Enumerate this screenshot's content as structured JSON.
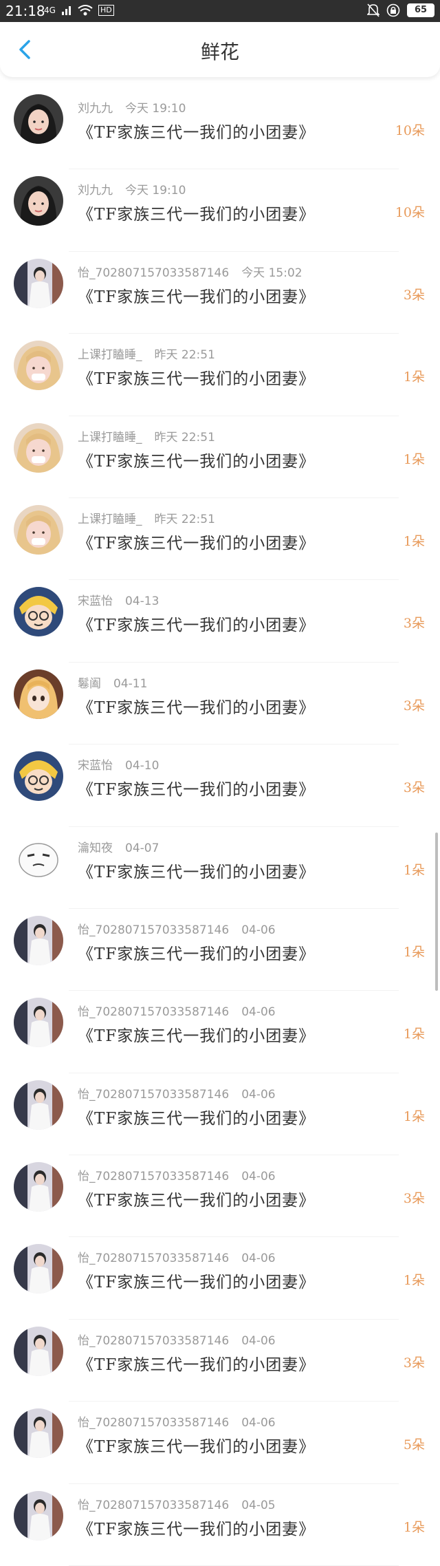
{
  "status_bar": {
    "time": "21:18",
    "signal": "4G",
    "network": "HD",
    "battery": "65"
  },
  "header": {
    "title": "鲜花"
  },
  "colors": {
    "count": "#e89a5a",
    "meta": "#9a9a9a"
  },
  "items": [
    {
      "name": "刘九九",
      "time": "今天 19:10",
      "message": "《TF家族三代一我们的小团妻》",
      "count": "10朵",
      "avatar": "girl-dark"
    },
    {
      "name": "刘九九",
      "time": "今天 19:10",
      "message": "《TF家族三代一我们的小团妻》",
      "count": "10朵",
      "avatar": "girl-dark"
    },
    {
      "name": "怡_7028071570335871​46",
      "time": "今天 15:02",
      "message": "《TF家族三代一我们的小团妻》",
      "count": "3朵",
      "avatar": "white-outfit"
    },
    {
      "name": "上课打瞌睡_",
      "time": "昨天 22:51",
      "message": "《TF家族三代一我们的小团妻》",
      "count": "1朵",
      "avatar": "blonde"
    },
    {
      "name": "上课打瞌睡_",
      "time": "昨天 22:51",
      "message": "《TF家族三代一我们的小团妻》",
      "count": "1朵",
      "avatar": "blonde"
    },
    {
      "name": "上课打瞌睡_",
      "time": "昨天 22:51",
      "message": "《TF家族三代一我们的小团妻》",
      "count": "1朵",
      "avatar": "blonde"
    },
    {
      "name": "宋蓝怡",
      "time": "04-13",
      "message": "《TF家族三代一我们的小团妻》",
      "count": "3朵",
      "avatar": "cartoon-glasses"
    },
    {
      "name": "鬈阖",
      "time": "04-11",
      "message": "《TF家族三代一我们的小团妻》",
      "count": "3朵",
      "avatar": "anime"
    },
    {
      "name": "宋蓝怡",
      "time": "04-10",
      "message": "《TF家族三代一我们的小团妻》",
      "count": "3朵",
      "avatar": "cartoon-glasses"
    },
    {
      "name": "瀹知夜",
      "time": "04-07",
      "message": "《TF家族三代一我们的小团妻》",
      "count": "1朵",
      "avatar": "meme-face"
    },
    {
      "name": "怡_702807157033587146",
      "time": "04-06",
      "message": "《TF家族三代一我们的小团妻》",
      "count": "1朵",
      "avatar": "white-outfit"
    },
    {
      "name": "怡_702807157033587146",
      "time": "04-06",
      "message": "《TF家族三代一我们的小团妻》",
      "count": "1朵",
      "avatar": "white-outfit"
    },
    {
      "name": "怡_702807157033587146",
      "time": "04-06",
      "message": "《TF家族三代一我们的小团妻》",
      "count": "1朵",
      "avatar": "white-outfit"
    },
    {
      "name": "怡_702807157033587146",
      "time": "04-06",
      "message": "《TF家族三代一我们的小团妻》",
      "count": "3朵",
      "avatar": "white-outfit"
    },
    {
      "name": "怡_702807157033587146",
      "time": "04-06",
      "message": "《TF家族三代一我们的小团妻》",
      "count": "1朵",
      "avatar": "white-outfit"
    },
    {
      "name": "怡_702807157033587146",
      "time": "04-06",
      "message": "《TF家族三代一我们的小团妻》",
      "count": "3朵",
      "avatar": "white-outfit"
    },
    {
      "name": "怡_702807157033587146",
      "time": "04-06",
      "message": "《TF家族三代一我们的小团妻》",
      "count": "5朵",
      "avatar": "white-outfit"
    },
    {
      "name": "怡_702807157033587146",
      "time": "04-05",
      "message": "《TF家族三代一我们的小团妻》",
      "count": "1朵",
      "avatar": "white-outfit"
    }
  ]
}
